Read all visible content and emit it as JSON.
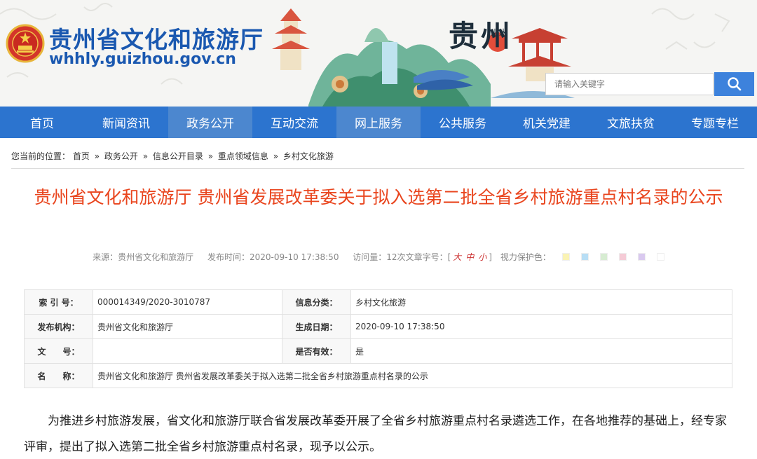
{
  "header": {
    "site_name": "贵州省文化和旅游厅",
    "site_url": "whhly.guizhou.gov.cn",
    "art_logo": "贵州",
    "art_logo_small": "山水",
    "search_placeholder": "请输入关键字"
  },
  "colors": {
    "brand_blue": "#1a58b0",
    "nav_blue": "#2c74cf",
    "title_red": "#e9451e",
    "search_button": "#3d82dc"
  },
  "nav": {
    "items": [
      {
        "label": "首页"
      },
      {
        "label": "新闻资讯"
      },
      {
        "label": "政务公开"
      },
      {
        "label": "互动交流"
      },
      {
        "label": "网上服务"
      },
      {
        "label": "公共服务"
      },
      {
        "label": "机关党建"
      },
      {
        "label": "文旅扶贫"
      },
      {
        "label": "专题专栏"
      }
    ]
  },
  "breadcrumb": {
    "prefix": "您当前的位置：",
    "items": [
      "首页",
      "政务公开",
      "信息公开目录",
      "重点领域信息",
      "乡村文化旅游"
    ],
    "separator": "»"
  },
  "article": {
    "title": "贵州省文化和旅游厅 贵州省发展改革委关于拟入选第二批全省乡村旅游重点村名录的公示",
    "source": "来源：贵州省文化和旅游厅",
    "publish_time": "发布时间：2020-09-10 17:38:50",
    "views": "访问量：12次",
    "font_size_label": "文章字号：[",
    "font_large": "大",
    "font_medium": "中",
    "font_small": "小",
    "font_size_end": "]",
    "eye_protect_label": "视力保护色：",
    "eye_colors": [
      "#faf3b4",
      "#b8def5",
      "#d7ecd2",
      "#f5cbd6",
      "#d9c9ef",
      "#ffffff"
    ]
  },
  "info_table": {
    "index_label": "索 引 号：",
    "index_value": "000014349/2020-3010787",
    "category_label": "信息分类：",
    "category_value": "乡村文化旅游",
    "publisher_label": "发布机构：",
    "publisher_value": "贵州省文化和旅游厅",
    "date_label": "生成日期：",
    "date_value": "2020-09-10 17:38:50",
    "doc_no_label": "文　　号：",
    "doc_no_value": "",
    "valid_label": "是否有效：",
    "valid_value": "是",
    "name_label": "名　　称：",
    "name_value": "贵州省文化和旅游厅 贵州省发展改革委关于拟入选第二批全省乡村旅游重点村名录的公示"
  },
  "body": {
    "paragraph": "为推进乡村旅游发展，省文化和旅游厅联合省发展改革委开展了全省乡村旅游重点村名录遴选工作，在各地推荐的基础上，经专家评审，提出了拟入选第二批全省乡村旅游重点村名录，现予以公示。"
  }
}
